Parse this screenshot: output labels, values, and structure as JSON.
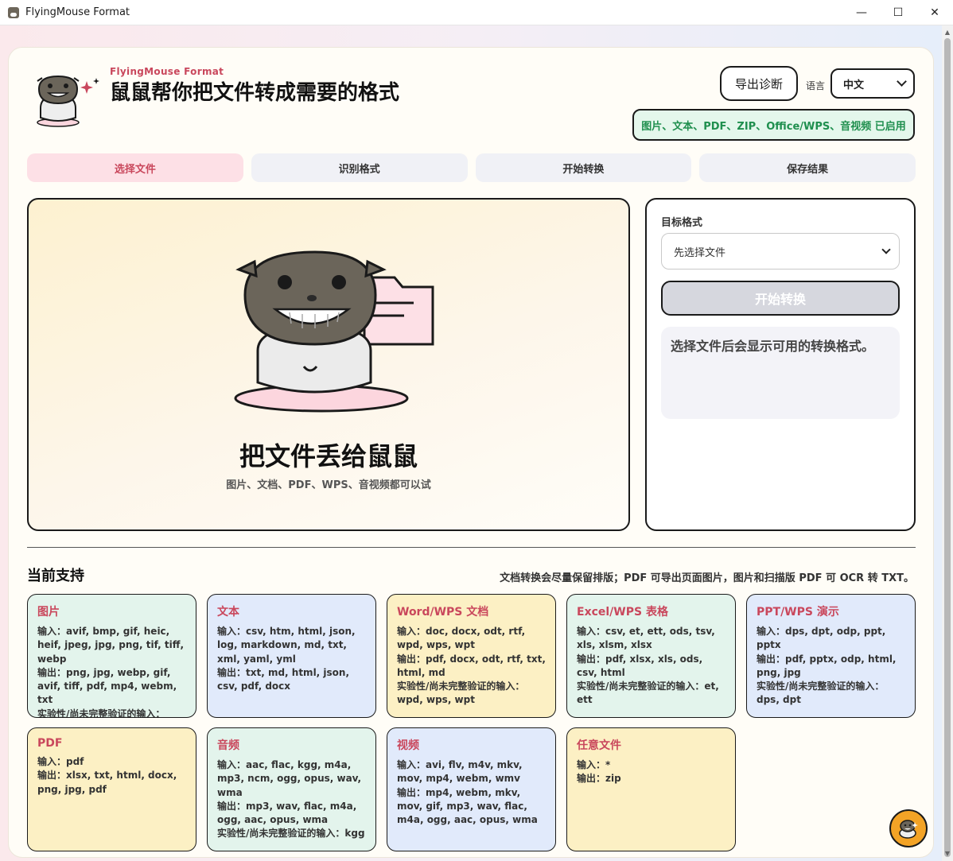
{
  "window": {
    "title": "FlyingMouse Format",
    "minimize": "—",
    "maximize": "☐",
    "close": "✕"
  },
  "header": {
    "brand": "FlyingMouse Format",
    "headline": "鼠鼠帮你把文件转成需要的格式",
    "export_label": "导出诊断",
    "lang_label": "语言",
    "lang_value": "中文",
    "status": "图片、文本、PDF、ZIP、Office/WPS、音视频 已启用"
  },
  "steps": [
    "选择文件",
    "识别格式",
    "开始转换",
    "保存结果"
  ],
  "dropzone": {
    "title": "把文件丢给鼠鼠",
    "subtitle": "图片、文档、PDF、WPS、音视频都可以试"
  },
  "side": {
    "target_label": "目标格式",
    "target_placeholder": "先选择文件",
    "start_label": "开始转换",
    "hint": "选择文件后会显示可用的转换格式。"
  },
  "support": {
    "title": "当前支持",
    "note": "文档转换会尽量保留排版；PDF 可导出页面图片，图片和扫描版 PDF 可 OCR 转 TXT。",
    "categories": [
      {
        "name": "图片",
        "color": "green",
        "lines": [
          "输入：avif, bmp, gif, heic, heif, jpeg, jpg, png, tif, tiff, webp",
          "输出：png, jpg, webp, gif, avif, tiff, pdf, mp4, webm, txt",
          "实验性/尚未完整验证的输入：heic, heif"
        ]
      },
      {
        "name": "文本",
        "color": "blue",
        "lines": [
          "输入：csv, htm, html, json, log, markdown, md, txt, xml, yaml, yml",
          "输出：txt, md, html, json, csv, pdf, docx"
        ]
      },
      {
        "name": "Word/WPS 文档",
        "color": "yellow",
        "lines": [
          "输入：doc, docx, odt, rtf, wpd, wps, wpt",
          "输出：pdf, docx, odt, rtf, txt, html, md",
          "实验性/尚未完整验证的输入：wpd, wps, wpt"
        ]
      },
      {
        "name": "Excel/WPS 表格",
        "color": "green",
        "lines": [
          "输入：csv, et, ett, ods, tsv, xls, xlsm, xlsx",
          "输出：pdf, xlsx, xls, ods, csv, html",
          "实验性/尚未完整验证的输入：et, ett"
        ]
      },
      {
        "name": "PPT/WPS 演示",
        "color": "blue",
        "lines": [
          "输入：dps, dpt, odp, ppt, pptx",
          "输出：pdf, pptx, odp, html, png, jpg",
          "实验性/尚未完整验证的输入：dps, dpt"
        ]
      },
      {
        "name": "PDF",
        "color": "yellow",
        "lines": [
          "输入：pdf",
          "输出：xlsx, txt, html, docx, png, jpg, pdf"
        ]
      },
      {
        "name": "音频",
        "color": "green",
        "lines": [
          "输入：aac, flac, kgg, m4a, mp3, ncm, ogg, opus, wav, wma",
          "输出：mp3, wav, flac, m4a, ogg, aac, opus, wma",
          "实验性/尚未完整验证的输入：kgg"
        ]
      },
      {
        "name": "视频",
        "color": "blue",
        "lines": [
          "输入：avi, flv, m4v, mkv, mov, mp4, webm, wmv",
          "输出：mp4, webm, mkv, mov, gif, mp3, wav, flac, m4a, ogg, aac, opus, wma"
        ]
      },
      {
        "name": "任意文件",
        "color": "yellow",
        "lines": [
          "输入：*",
          "输出：zip"
        ]
      }
    ]
  }
}
